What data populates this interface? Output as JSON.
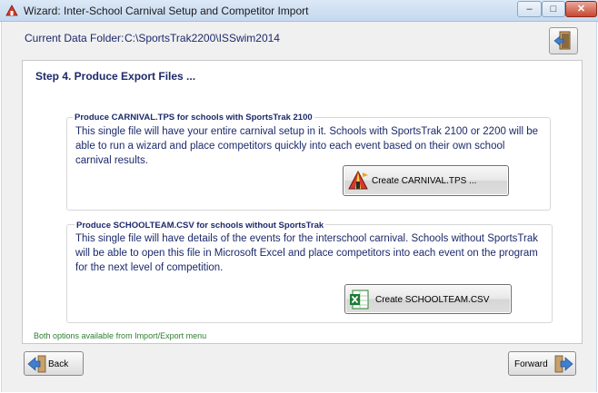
{
  "window": {
    "title": "Wizard: Inter-School Carnival Setup and Competitor Import",
    "minimize": "–",
    "maximize": "□",
    "close": "✕"
  },
  "header": {
    "folder_label": "Current Data Folder:",
    "folder_value": "C:\\SportsTrak2200\\ISSwim2014",
    "exit_icon": "exit-door-icon"
  },
  "step": {
    "title": "Step 4. Produce Export Files ..."
  },
  "carnival_group": {
    "legend": "Produce CARNIVAL.TPS for schools with SportsTrak 2100",
    "description": "This single file will have your entire carnival setup in it.  Schools with SportsTrak 2100 or 2200 will be able to run a wizard and place competitors quickly into each event based on their own school carnival results.",
    "button_label": "Create CARNIVAL.TPS ...",
    "button_icon": "carnival-tent-icon"
  },
  "schoolteam_group": {
    "legend": "Produce SCHOOLTEAM.CSV for schools without SportsTrak",
    "description": "This single file will have details of the events for the interschool carnival. Schools without SportsTrak will be able to open this file in Microsoft Excel and place competitors into each event on the program for the next level of competition.",
    "button_label": "Create SCHOOLTEAM.CSV",
    "button_icon": "excel-icon"
  },
  "footnote": "Both options available from Import/Export menu",
  "nav": {
    "back_label": "Back",
    "forward_label": "Forward"
  }
}
